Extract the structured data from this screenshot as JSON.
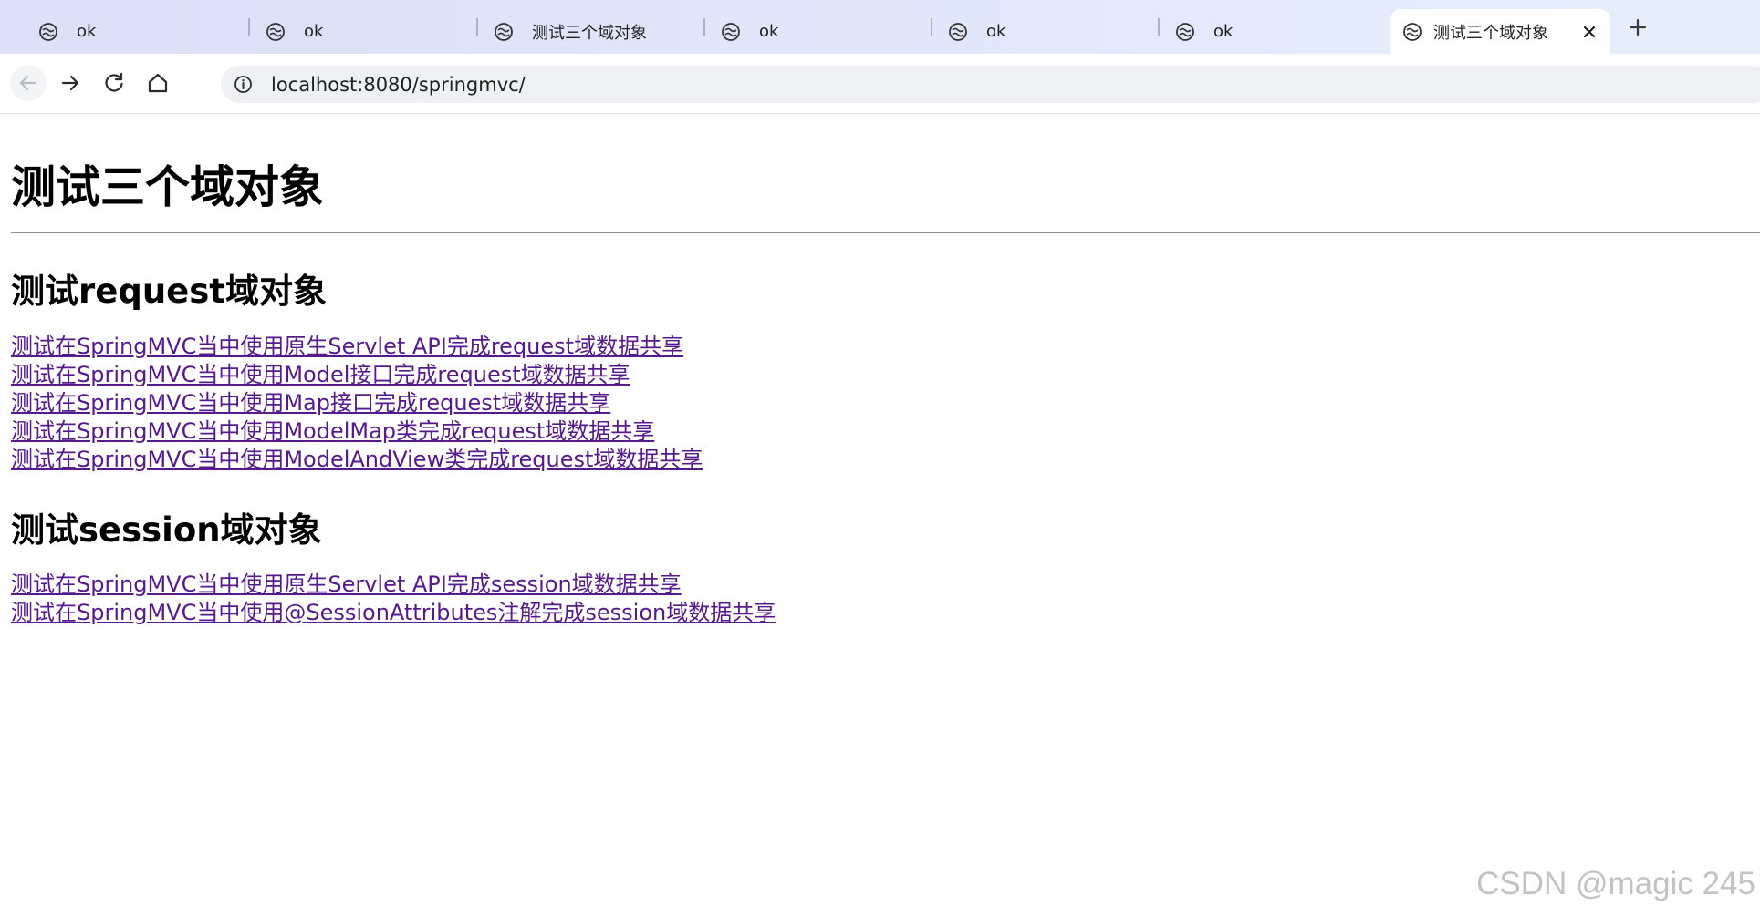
{
  "browser": {
    "tabs": [
      {
        "title": "ok",
        "active": false
      },
      {
        "title": "ok",
        "active": false
      },
      {
        "title": "测试三个域对象",
        "active": false
      },
      {
        "title": "ok",
        "active": false
      },
      {
        "title": "ok",
        "active": false
      },
      {
        "title": "ok",
        "active": false
      },
      {
        "title": "测试三个域对象",
        "active": true
      }
    ],
    "url": "localhost:8080/springmvc/"
  },
  "page": {
    "title": "测试三个域对象",
    "request_section": {
      "heading": "测试request域对象",
      "links": [
        "测试在SpringMVC当中使用原生Servlet API完成request域数据共享",
        "测试在SpringMVC当中使用Model接口完成request域数据共享",
        "测试在SpringMVC当中使用Map接口完成request域数据共享",
        "测试在SpringMVC当中使用ModelMap类完成request域数据共享",
        "测试在SpringMVC当中使用ModelAndView类完成request域数据共享"
      ]
    },
    "session_section": {
      "heading": "测试session域对象",
      "links": [
        "测试在SpringMVC当中使用原生Servlet API完成session域数据共享",
        "测试在SpringMVC当中使用@SessionAttributes注解完成session域数据共享"
      ]
    }
  },
  "watermark": "CSDN @magic 245",
  "colors": {
    "link_visited": "#551a8b",
    "tabstrip": "#dcdff8",
    "omnibox": "#eef0f3"
  }
}
